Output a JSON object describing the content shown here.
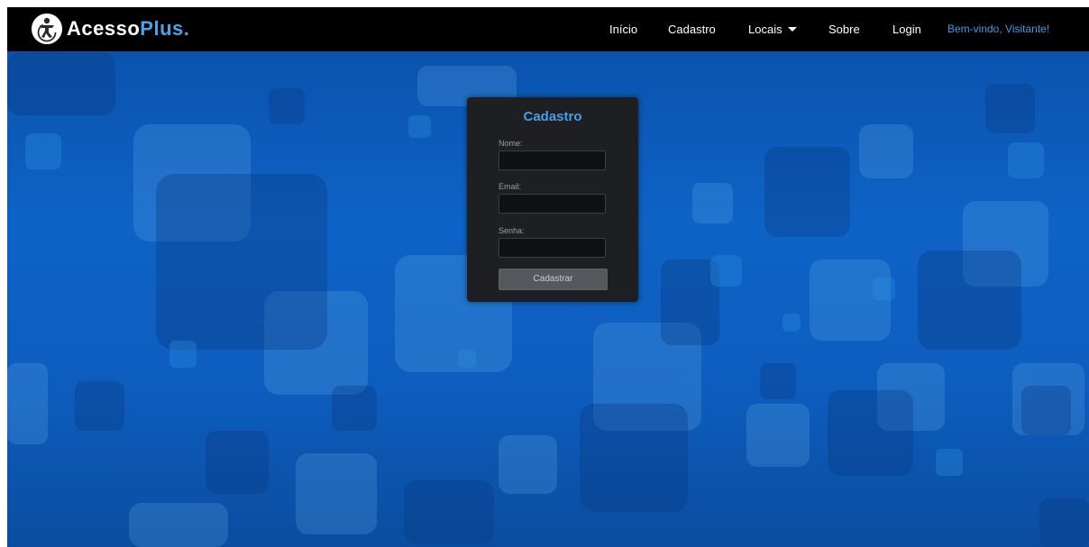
{
  "brand": {
    "name_main": "Acesso",
    "name_accent": "Plus."
  },
  "nav": {
    "items": [
      {
        "label": "Início"
      },
      {
        "label": "Cadastro"
      },
      {
        "label": "Locais"
      },
      {
        "label": "Sobre"
      },
      {
        "label": "Login"
      }
    ],
    "welcome": "Bem-vindo, Visitante!"
  },
  "form": {
    "title": "Cadastro",
    "fields": [
      {
        "label": "Nome:",
        "value": ""
      },
      {
        "label": "Email:",
        "value": ""
      },
      {
        "label": "Senha:",
        "value": ""
      }
    ],
    "submit_label": "Cadastrar"
  },
  "colors": {
    "accent": "#4a9de4",
    "navbar": "#000000",
    "panel": "#1d1f22",
    "background": "#0d5dbf"
  }
}
